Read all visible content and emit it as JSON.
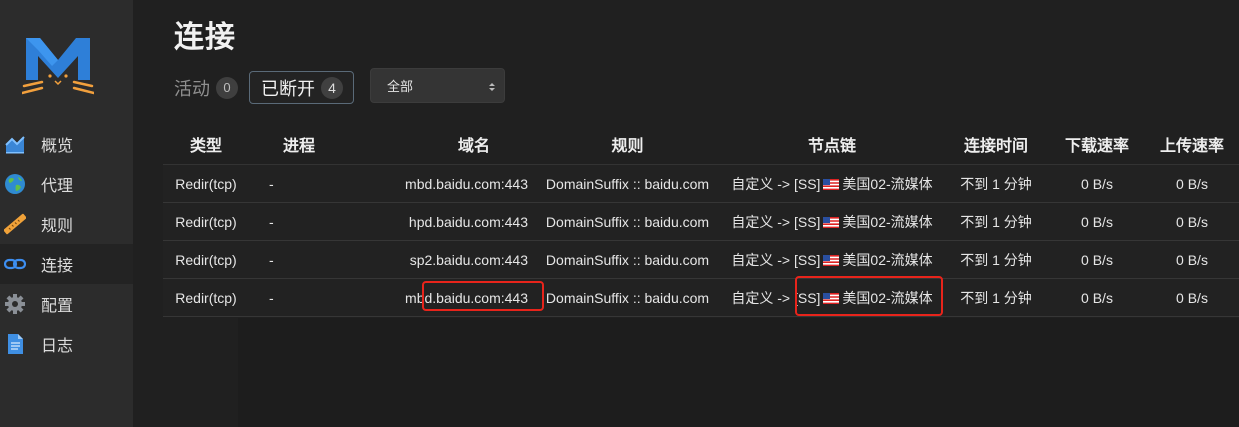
{
  "sidebar": {
    "items": [
      {
        "label": "概览",
        "icon": "chart-area-icon"
      },
      {
        "label": "代理",
        "icon": "globe-icon"
      },
      {
        "label": "规则",
        "icon": "ruler-icon"
      },
      {
        "label": "连接",
        "icon": "link-icon"
      },
      {
        "label": "配置",
        "icon": "gear-icon"
      },
      {
        "label": "日志",
        "icon": "document-icon"
      }
    ],
    "active": "连接"
  },
  "header": {
    "title": "连接"
  },
  "tabs": {
    "active_label": "活动",
    "active_count": "0",
    "closed_label": "已断开",
    "closed_count": "4"
  },
  "filter": {
    "selected": "全部"
  },
  "table": {
    "columns": [
      "类型",
      "进程",
      "域名",
      "规则",
      "节点链",
      "连接时间",
      "下载速率",
      "上传速率"
    ],
    "rows": [
      {
        "type": "Redir(tcp)",
        "process": "-",
        "host": "mbd.baidu.com:443",
        "rule": "DomainSuffix :: baidu.com",
        "chain_prefix": "自定义 -> [SS]",
        "chain_node": "美国02-流媒体",
        "time": "不到 1 分钟",
        "down": "0 B/s",
        "up": "0 B/s"
      },
      {
        "type": "Redir(tcp)",
        "process": "-",
        "host": "hpd.baidu.com:443",
        "rule": "DomainSuffix :: baidu.com",
        "chain_prefix": "自定义 -> [SS]",
        "chain_node": "美国02-流媒体",
        "time": "不到 1 分钟",
        "down": "0 B/s",
        "up": "0 B/s"
      },
      {
        "type": "Redir(tcp)",
        "process": "-",
        "host": "sp2.baidu.com:443",
        "rule": "DomainSuffix :: baidu.com",
        "chain_prefix": "自定义 -> [SS]",
        "chain_node": "美国02-流媒体",
        "time": "不到 1 分钟",
        "down": "0 B/s",
        "up": "0 B/s"
      },
      {
        "type": "Redir(tcp)",
        "process": "-",
        "host": "mbd.baidu.com:443",
        "rule": "DomainSuffix :: baidu.com",
        "chain_prefix": "自定义 -> [SS]",
        "chain_node": "美国02-流媒体",
        "time": "不到 1 分钟",
        "down": "0 B/s",
        "up": "0 B/s"
      }
    ]
  },
  "colors": {
    "annotation_red": "#e8241b",
    "logo_blue": "#2e7fd8",
    "logo_orange": "#f2a03d"
  }
}
